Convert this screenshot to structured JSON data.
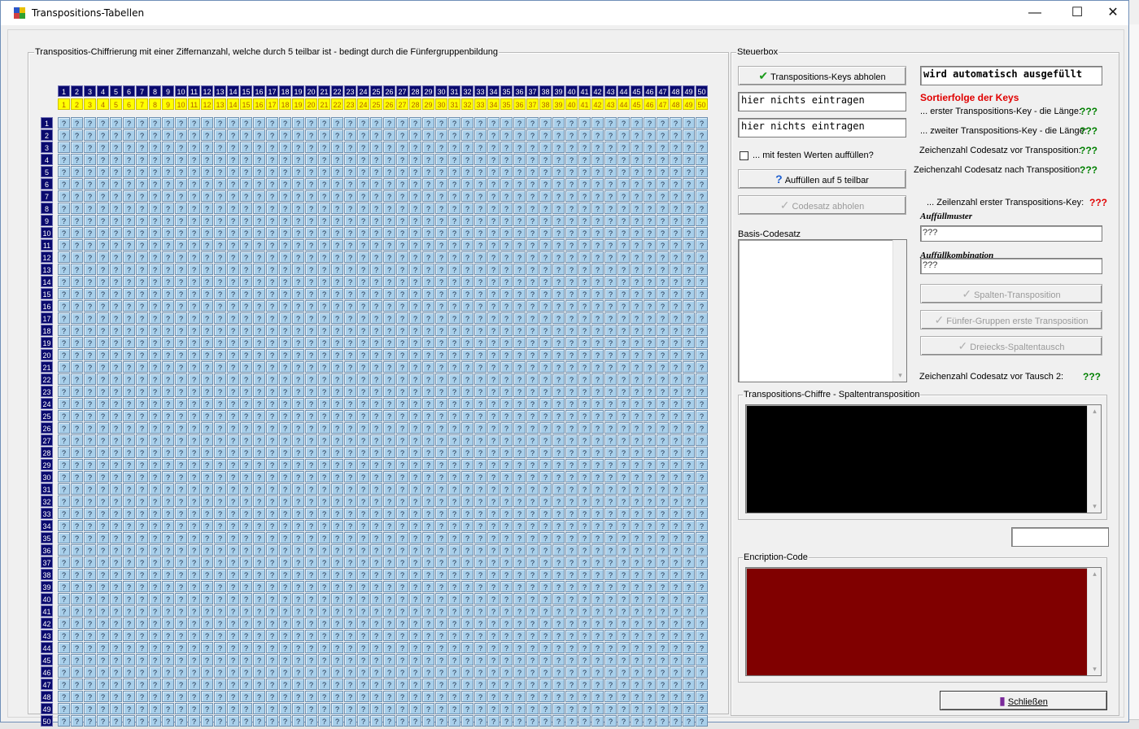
{
  "window": {
    "title": "Transpositions-Tabellen",
    "minimize_glyph": "—",
    "maximize_glyph": "☐",
    "close_glyph": "✕"
  },
  "grid_group": {
    "label": "Transpositios-Chiffrierung mit einer Ziffernanzahl, welche durch 5 teilbar ist - bedingt durch die Fünfergruppenbildung",
    "columns": 50,
    "rows": 50,
    "cell_value": "?"
  },
  "steuerbox": {
    "label": "Steuerbox",
    "btn_keys": "Transpositions-Keys abholen",
    "auto_field": "wird automatisch ausgefüllt",
    "key_field_1": "hier nichts eintragen",
    "key_field_2": "hier nichts eintragen",
    "fill_checkbox_label": "... mit festen Werten auffüllen?",
    "btn_auffuellen": "Auffüllen auf 5 teilbar",
    "btn_codesatz": "Codesatz abholen",
    "sort_heading": "Sortierfolge der Keys",
    "first_key_label": "... erster Transpositions-Key - die Länge:",
    "first_key_value": "???",
    "second_key_label": "... zweiter Transpositions-Key - die Länge:",
    "second_key_value": "???",
    "count_before_label": "Zeichenzahl Codesatz vor Transposition:",
    "count_before_value": "???",
    "count_after_label": "Zeichenzahl Codesatz nach Transposition:",
    "count_after_value": "???",
    "rows_label": "... Zeilenzahl erster Transpositions-Key:",
    "rows_value": "???",
    "fill_pattern_label": "Auffüllmuster",
    "fill_pattern_value": "???",
    "fill_combo_label": "Auffüllkombination",
    "fill_combo_value": "???",
    "basis_label": "Basis-Codesatz",
    "btn_spalten": "Spalten-Transposition",
    "btn_fuenfer": "Fünfer-Gruppen erste Transposition",
    "btn_dreieck": "Dreiecks-Spaltentausch",
    "tausch_label": "Zeichenzahl Codesatz vor Tausch 2:",
    "tausch_value": "???",
    "chiffre_label": "Transpositions-Chiffre - Spaltentransposition",
    "encription_label": "Encription-Code",
    "btn_close": "Schließen"
  },
  "colors": {
    "header_blue": "#0a0a6e",
    "header_yellow": "#ffff00",
    "cell_blue": "#a8cfea",
    "green_value": "#008000",
    "red_value": "#e00000",
    "chiffre_bg": "#000000",
    "encription_bg": "#800000"
  }
}
